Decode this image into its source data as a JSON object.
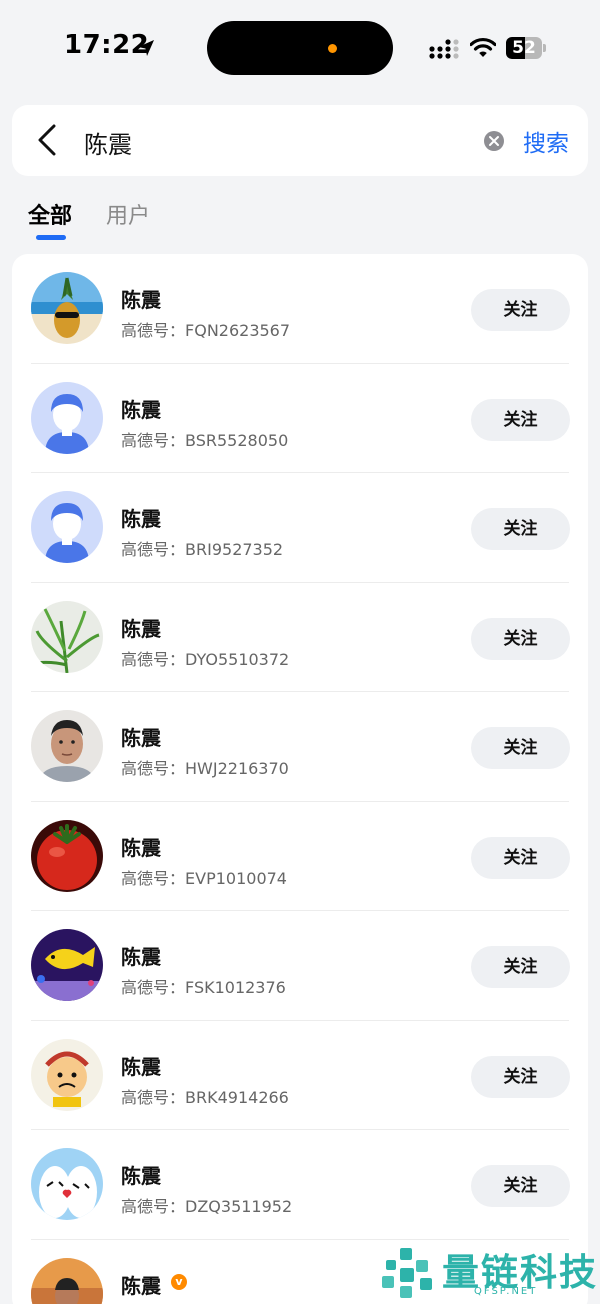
{
  "status_bar": {
    "time": "17:22",
    "battery_level": "52",
    "icons": [
      "location-arrow-icon",
      "cellular-signal-icon",
      "wifi-icon",
      "battery-icon"
    ]
  },
  "search": {
    "query": "陈震",
    "submit_label": "搜索",
    "icons": [
      "back-chevron-icon",
      "clear-icon"
    ]
  },
  "tabs": [
    {
      "label": "全部",
      "active": true
    },
    {
      "label": "用户",
      "active": false
    }
  ],
  "results": [
    {
      "name": "陈震",
      "gaode_label": "高德号：",
      "gaode_id": "FQN2623567",
      "follow_label": "关注",
      "avatar": "pineapple-beach-photo"
    },
    {
      "name": "陈震",
      "gaode_label": "高德号：",
      "gaode_id": "BSR5528050",
      "follow_label": "关注",
      "avatar": "default-user"
    },
    {
      "name": "陈震",
      "gaode_label": "高德号：",
      "gaode_id": "BRI9527352",
      "follow_label": "关注",
      "avatar": "default-user"
    },
    {
      "name": "陈震",
      "gaode_label": "高德号：",
      "gaode_id": "DYO5510372",
      "follow_label": "关注",
      "avatar": "green-plant-photo"
    },
    {
      "name": "陈震",
      "gaode_label": "高德号：",
      "gaode_id": "HWJ2216370",
      "follow_label": "关注",
      "avatar": "man-portrait-photo"
    },
    {
      "name": "陈震",
      "gaode_label": "高德号：",
      "gaode_id": "EVP1010074",
      "follow_label": "关注",
      "avatar": "tomato-photo"
    },
    {
      "name": "陈震",
      "gaode_label": "高德号：",
      "gaode_id": "FSK1012376",
      "follow_label": "关注",
      "avatar": "yellow-fish-photo"
    },
    {
      "name": "陈震",
      "gaode_label": "高德号：",
      "gaode_id": "BRK4914266",
      "follow_label": "关注",
      "avatar": "cartoon-character"
    },
    {
      "name": "陈震",
      "gaode_label": "高德号：",
      "gaode_id": "DZQ3511952",
      "follow_label": "关注",
      "avatar": "couple-cartoon"
    },
    {
      "name": "陈震",
      "gaode_label": "",
      "gaode_id": "",
      "follow_label": "",
      "avatar": "man-sunset-photo",
      "verified": true
    }
  ],
  "watermark": {
    "title": "量链科技",
    "subtitle": "QFSP.NET"
  },
  "colors": {
    "accent": "#1f6cf5",
    "background": "#f3f4f6",
    "card": "#ffffff",
    "button_bg": "#eef0f3",
    "secondary_text": "#666666",
    "watermark": "#2db3aa",
    "verified_badge": "#ff8a00"
  }
}
